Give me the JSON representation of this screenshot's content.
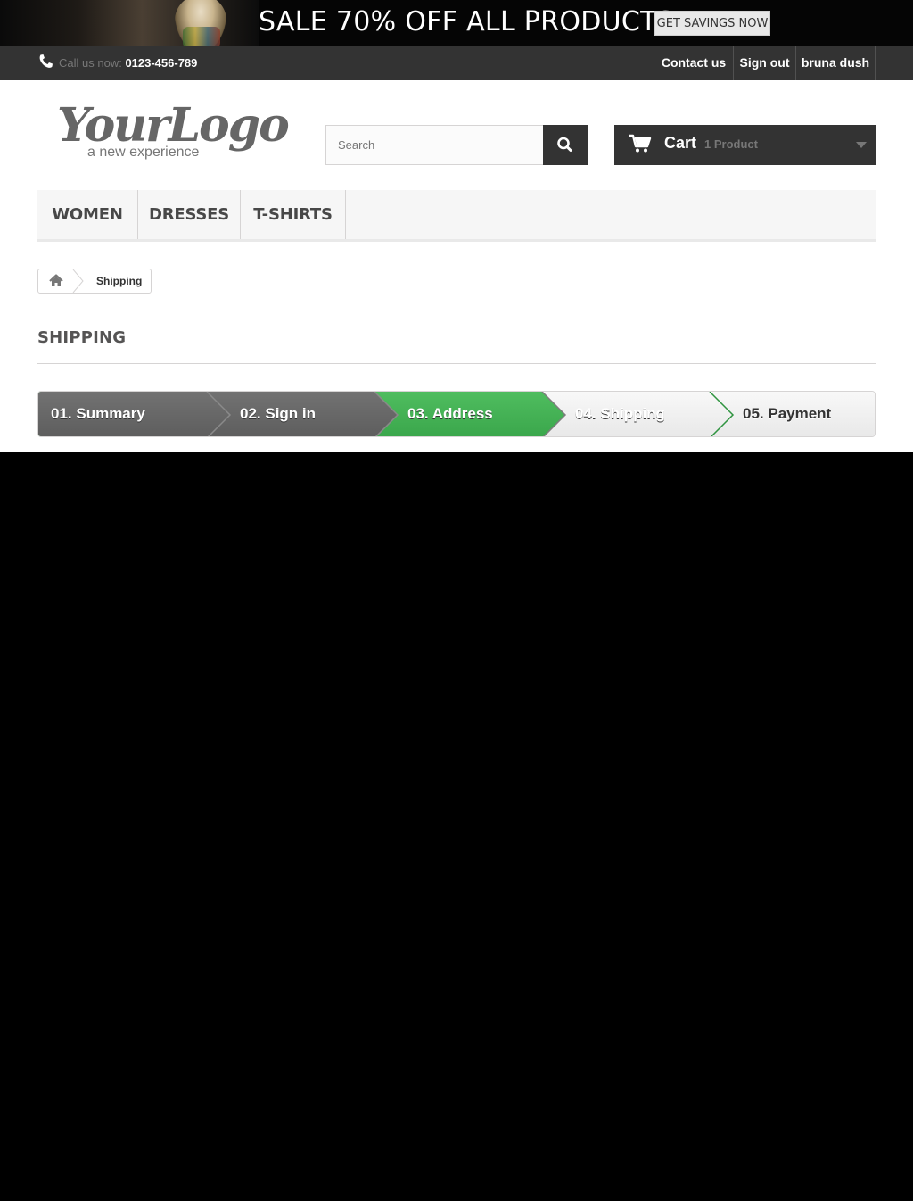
{
  "banner": {
    "headline": "SALE 70% OFF ALL PRODUCTS",
    "cta_label": "GET SAVINGS NOW"
  },
  "topnav": {
    "call_prefix": "Call us now:",
    "phone": "0123-456-789",
    "links": [
      "Contact us",
      "Sign out",
      "bruna dush"
    ]
  },
  "header": {
    "logo_script": "YourLogo",
    "logo_tagline": "a new experience",
    "search_placeholder": "Search",
    "cart_label": "Cart",
    "cart_count": "1 Product"
  },
  "menu": {
    "items": [
      "WOMEN",
      "DRESSES",
      "T-SHIRTS"
    ]
  },
  "breadcrumb": {
    "current": "Shipping"
  },
  "page": {
    "heading": "SHIPPING"
  },
  "steps": {
    "items": [
      "01. Summary",
      "02. Sign in",
      "03. Address",
      "04. Shipping",
      "05. Payment"
    ],
    "current": "04. Shipping",
    "colors": {
      "done": "#666666",
      "current": "#43b155",
      "todo": "#f2f2f2"
    }
  }
}
